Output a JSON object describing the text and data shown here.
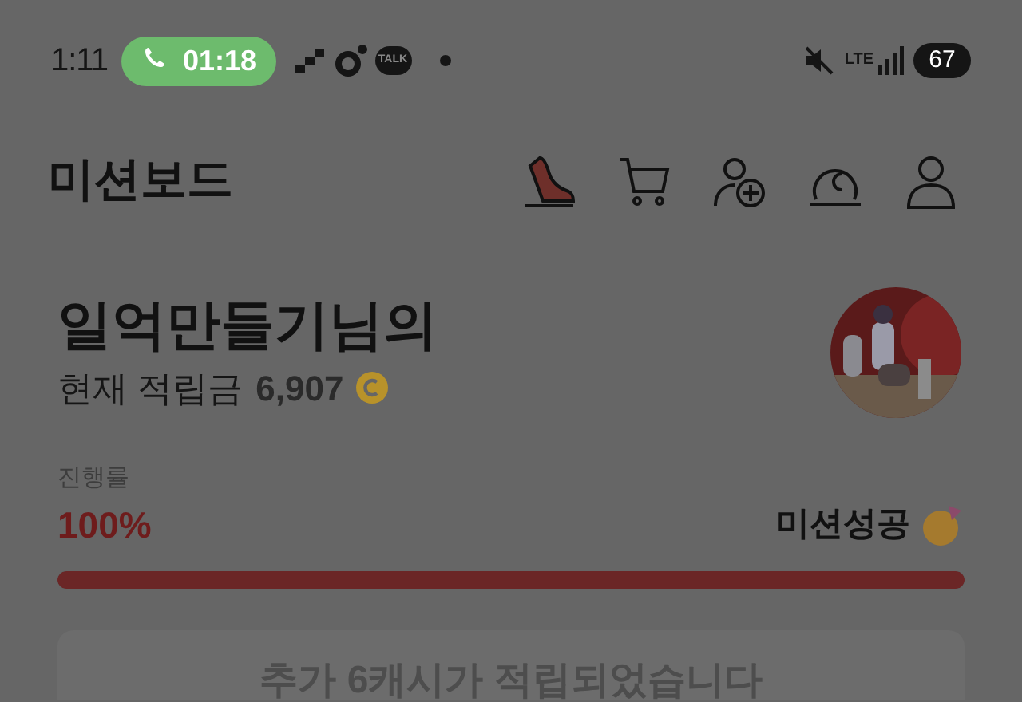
{
  "status_bar": {
    "time": "1:11",
    "call_timer": "01:18",
    "talk_label": "TALK",
    "network": "LTE",
    "battery": "67"
  },
  "header": {
    "title": "미션보드"
  },
  "user": {
    "name": "일억만들기님의",
    "balance_label": "현재 적립금",
    "balance": "6,907"
  },
  "progress": {
    "label": "진행률",
    "percent": "100%",
    "status": "미션성공",
    "level": 1
  },
  "notice": "추가 6캐시가 적립되었습니다"
}
